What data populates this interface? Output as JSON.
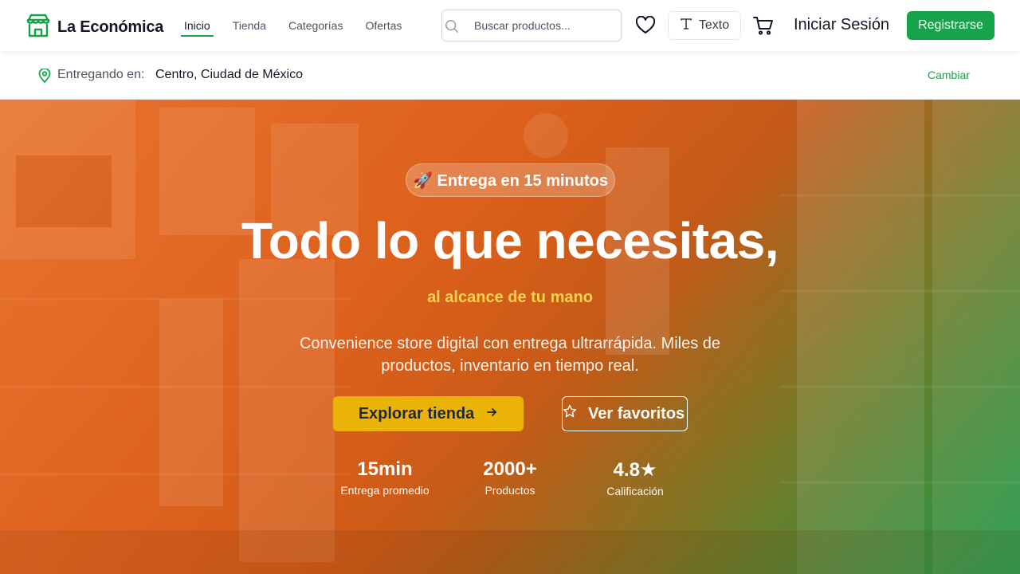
{
  "header": {
    "brand": "La Económica",
    "nav": [
      {
        "label": "Inicio",
        "active": true
      },
      {
        "label": "Tienda",
        "active": false
      },
      {
        "label": "Categorías",
        "active": false
      },
      {
        "label": "Ofertas",
        "active": false
      }
    ],
    "search": {
      "placeholder": "Buscar productos...",
      "value": ""
    },
    "text_button": "Texto",
    "login": "Iniciar Sesión",
    "register": "Registrarse"
  },
  "delivery": {
    "label": "Entregando en:",
    "location": "Centro, Ciudad de México",
    "change": "Cambiar"
  },
  "hero": {
    "badge": "🚀 Entrega en 15 minutos",
    "title": "Todo lo que necesitas,",
    "subtitle": "al alcance de tu mano",
    "description": "Convenience store digital con entrega ultrarrápida. Miles de productos, inventario en tiempo real.",
    "primary_cta": "Explorar tienda",
    "secondary_cta": "Ver favoritos",
    "stats": [
      {
        "value": "15min",
        "label": "Entrega promedio"
      },
      {
        "value": "2000+",
        "label": "Productos"
      },
      {
        "value": "4.8★",
        "label": "Calificación"
      }
    ]
  },
  "colors": {
    "brand_green": "#16a34a",
    "cta_yellow": "#eab308",
    "subtitle_yellow": "#fcd34d",
    "hero_orange": "#e3722f"
  },
  "icons": [
    "store-logo-icon",
    "search-icon",
    "heart-icon",
    "type-icon",
    "cart-icon",
    "map-pin-icon",
    "arrow-right-icon",
    "star-outline-icon"
  ]
}
